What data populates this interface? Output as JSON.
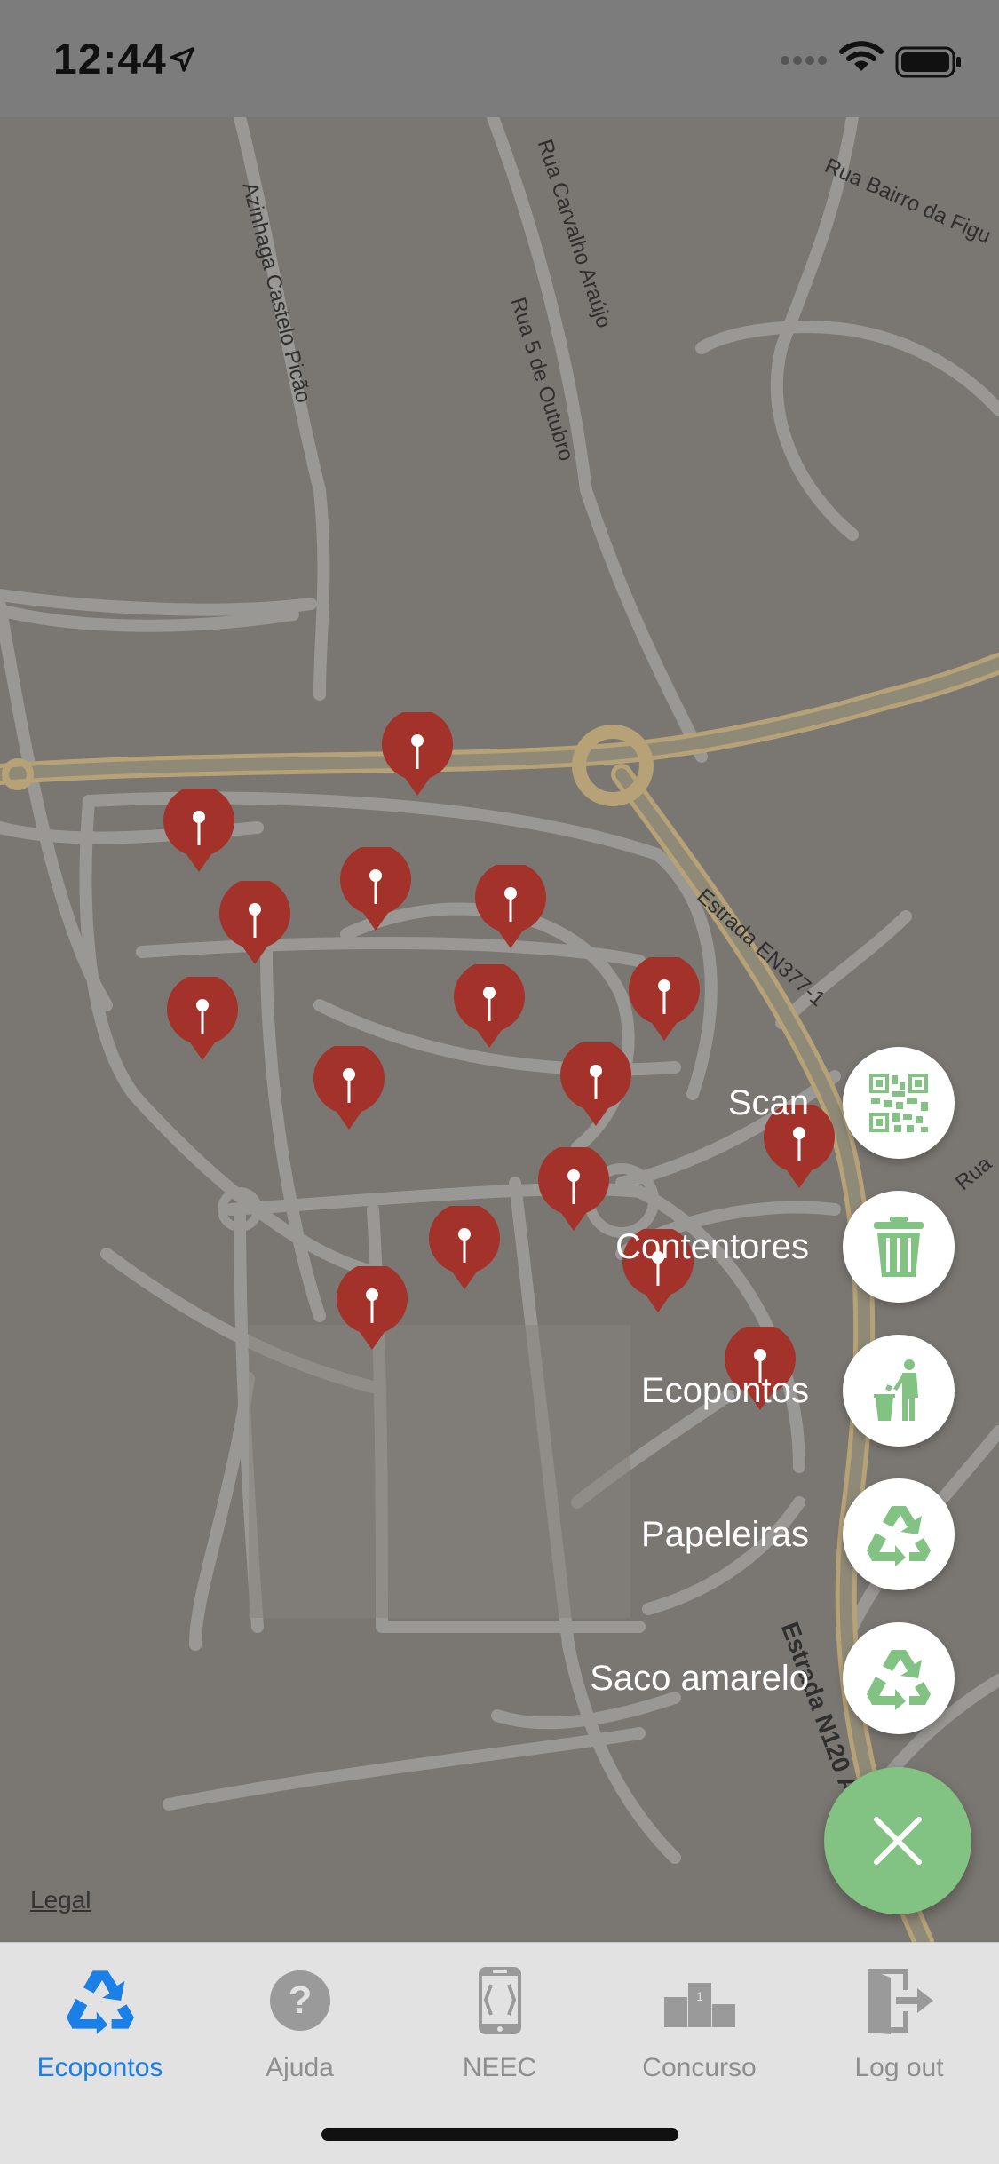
{
  "status_bar": {
    "time": "12:44"
  },
  "map": {
    "streets": {
      "rua_bairro": "Rua Bairro da Figu",
      "rua_carvalho": "Rua Carvalho Araújo",
      "rua_5_outubro": "Rua 5 de Outubro",
      "azinhaga": "Azinhaga Castelo Picão",
      "estrada_en377": "Estrada EN377-1",
      "estrada_bottom": "Estrada N120 Ac",
      "rua_right": "Rua"
    },
    "legal": "Legal"
  },
  "fab_menu": {
    "items": [
      {
        "label": "Scan",
        "icon": "qr-code-icon"
      },
      {
        "label": "Contentores",
        "icon": "trash-can-icon"
      },
      {
        "label": "Ecopontos",
        "icon": "person-disposing-trash-icon"
      },
      {
        "label": "Papeleiras",
        "icon": "recycle-icon"
      },
      {
        "label": "Saco amarelo",
        "icon": "recycle-icon"
      }
    ],
    "close_icon": "close-icon",
    "accent": "#82c282"
  },
  "tab_bar": {
    "tabs": [
      {
        "label": "Ecopontos",
        "icon": "recycle-icon",
        "active": true
      },
      {
        "label": "Ajuda",
        "icon": "help-icon",
        "active": false
      },
      {
        "label": "NEEC",
        "icon": "phone-icon",
        "active": false
      },
      {
        "label": "Concurso",
        "icon": "podium-icon",
        "active": false
      },
      {
        "label": "Log out",
        "icon": "logout-icon",
        "active": false
      }
    ],
    "active_color": "#1a7fe6",
    "inactive_color": "#8e8e8e"
  },
  "pin_color": "#a3322a"
}
